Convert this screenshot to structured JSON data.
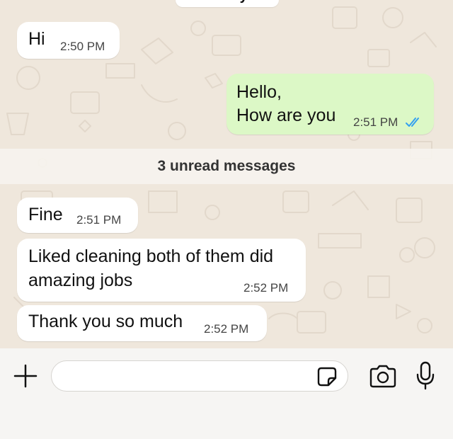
{
  "date_label": "Today",
  "messages": [
    {
      "direction": "incoming",
      "lines": [
        "Hi"
      ],
      "time": "2:50 PM"
    },
    {
      "direction": "outgoing",
      "lines": [
        "Hello,",
        "How are you"
      ],
      "time": "2:51 PM",
      "status": "read",
      "status_icon": "double-check-icon"
    },
    {
      "direction": "incoming",
      "lines": [
        "Fine"
      ],
      "time": "2:51 PM"
    },
    {
      "direction": "incoming",
      "lines": [
        "Liked cleaning both of them did",
        "amazing jobs"
      ],
      "time": "2:52 PM"
    },
    {
      "direction": "incoming",
      "lines": [
        "Thank you so much"
      ],
      "time": "2:52 PM"
    }
  ],
  "unread_divider": "3 unread messages",
  "composer": {
    "placeholder": "",
    "value": "",
    "icons": [
      "plus-icon",
      "sticker-icon",
      "camera-icon",
      "microphone-icon"
    ]
  },
  "colors": {
    "wallpaper": "#efe7dc",
    "incoming_bubble": "#ffffff",
    "outgoing_bubble": "#dcf8c6",
    "read_check": "#34a0f0"
  }
}
